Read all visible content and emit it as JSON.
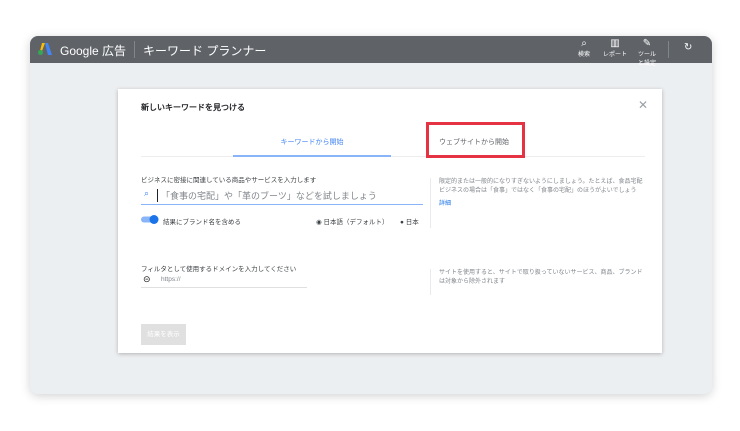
{
  "header": {
    "brand": "Google 広告",
    "title": "キーワード プランナー",
    "icons": [
      {
        "name": "search-icon",
        "label": "検索"
      },
      {
        "name": "report-icon",
        "label": "レポート"
      },
      {
        "name": "wrench-icon",
        "label": "ツールと設定"
      }
    ],
    "refresh": "refresh-icon"
  },
  "dialog": {
    "title": "新しいキーワードを見つける",
    "tabs": [
      {
        "label": "キーワードから開始",
        "active": true
      },
      {
        "label": "ウェブサイトから開始",
        "active": false,
        "highlighted": true
      }
    ],
    "keyword_label": "ビジネスに密接に関連している商品やサービスを入力します",
    "keyword_placeholder": "「食事の宅配」や「革のブーツ」などを試しましょう",
    "brand_toggle": "結果にブランド名を含める",
    "language": "日本語（デフォルト）",
    "location": "日本",
    "tip": "限定的または一般的になりすぎないようにしましょう。たとえば、食品宅配ビジネスの場合は「食事」ではなく「食事の宅配」のほうがよいでしょう",
    "tip_link": "詳細",
    "domain_label": "フィルタとして使用するドメインを入力してください",
    "domain_placeholder": "https://",
    "domain_tip": "サイトを使用すると、サイトで取り扱っていないサービス、商品、ブランドは対象から除外されます",
    "submit": "結果を表示"
  },
  "colors": {
    "accent": "#4285f4",
    "highlight": "#e53343",
    "header": "#5f6368"
  }
}
